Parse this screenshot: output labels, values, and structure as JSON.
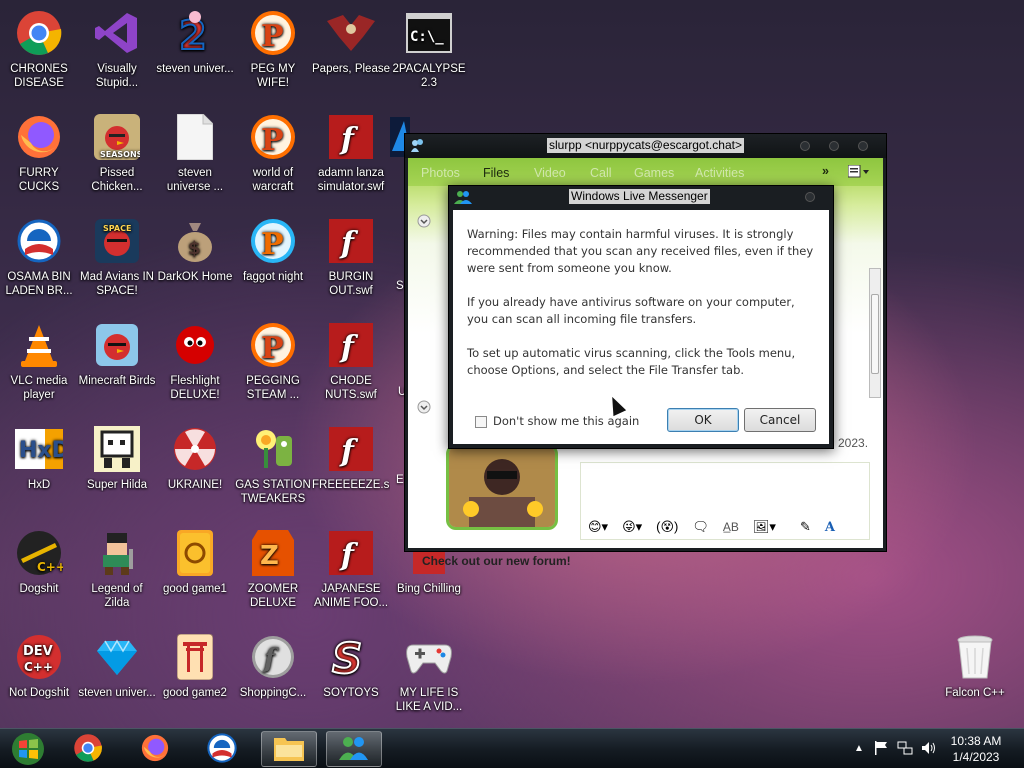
{
  "desktop": {
    "icons": [
      {
        "label": "CHRONES DISEASE",
        "icon": "chrome-icon"
      },
      {
        "label": "Visually Stupid...",
        "icon": "visual-studio-icon"
      },
      {
        "label": "steven univer...",
        "icon": "steven-universe-icon"
      },
      {
        "label": "PEG MY WIFE!",
        "icon": "peggle-icon"
      },
      {
        "label": "Papers, Please",
        "icon": "papers-please-icon"
      },
      {
        "label": "2PACALYPSE 2.3",
        "icon": "terminal-icon"
      },
      {
        "label": "FURRY CUCKS",
        "icon": "firefox-icon"
      },
      {
        "label": "Pissed Chicken...",
        "icon": "angry-birds-seasons-icon"
      },
      {
        "label": "steven universe ...",
        "icon": "blank-file-icon"
      },
      {
        "label": "world of warcraft",
        "icon": "peggle-icon"
      },
      {
        "label": "adamn lanza simulator.swf",
        "icon": "flash-icon"
      },
      {
        "label": "OSAMA BIN LADEN BR...",
        "icon": "obama-logo-icon"
      },
      {
        "label": "Mad Avians IN SPACE!",
        "icon": "angry-birds-space-icon"
      },
      {
        "label": "DarkOK Home",
        "icon": "money-bag-icon"
      },
      {
        "label": "faggot night",
        "icon": "peggle-nights-icon"
      },
      {
        "label": "BURGIN OUT.swf",
        "icon": "flash-icon"
      },
      {
        "label": "VLC media player",
        "icon": "vlc-icon"
      },
      {
        "label": "Minecraft Birds",
        "icon": "angry-birds-icon"
      },
      {
        "label": "Fleshlight DELUXE!",
        "icon": "red-fluffy-icon"
      },
      {
        "label": "PEGGING STEAM ...",
        "icon": "peggle-icon"
      },
      {
        "label": "CHODE NUTS.swf",
        "icon": "flash-icon"
      },
      {
        "label": "HxD",
        "icon": "hxd-icon"
      },
      {
        "label": "Super Hilda",
        "icon": "pixel-sprite-icon"
      },
      {
        "label": "UKRAINE!",
        "icon": "radiation-icon"
      },
      {
        "label": "GAS STATION TWEAKERS",
        "icon": "plants-zombies-icon"
      },
      {
        "label": "FREEEEEZE.s...",
        "icon": "flash-icon"
      },
      {
        "label": "Dogshit",
        "icon": "codeblocks-icon"
      },
      {
        "label": "Legend of Zilda",
        "icon": "pixel-hero-icon"
      },
      {
        "label": "good game1",
        "icon": "mahjong-tile-icon"
      },
      {
        "label": "ZOOMER DELUXE",
        "icon": "zuma-icon"
      },
      {
        "label": "JAPANESE ANIME FOO...",
        "icon": "flash-icon"
      },
      {
        "label": "Bing Chilling",
        "icon": "game-box-icon"
      },
      {
        "label": "Not Dogshit",
        "icon": "devcpp-icon"
      },
      {
        "label": "steven univer...",
        "icon": "gem-icon"
      },
      {
        "label": "good game2",
        "icon": "mahjong-gate-icon"
      },
      {
        "label": "ShoppingC...",
        "icon": "flash-player-icon"
      },
      {
        "label": "SOYTOYS",
        "icon": "soytoys-icon"
      },
      {
        "label": "MY LIFE IS LIKE A VID...",
        "icon": "gamepad-icon"
      },
      {
        "label": "Falcon C++",
        "icon": "recycle-bin-icon"
      }
    ],
    "partial_labels": {
      "s": "S",
      "u": "U",
      "e": "E"
    }
  },
  "messenger": {
    "title": "slurpp <nurppycats@escargot.chat>",
    "tabs": [
      "Photos",
      "Files",
      "Video",
      "Call",
      "Games",
      "Activities"
    ],
    "active_tab": "Files",
    "more": "»",
    "date_fragment": "2023.",
    "footer": "Check out our new forum!"
  },
  "dialog": {
    "title": "Windows Live Messenger",
    "para1": "Warning: Files may contain harmful viruses. It is strongly recommended that you scan any received files, even if they were sent from someone you know.",
    "para2": "If you already have antivirus software on your computer, you can scan all incoming file transfers.",
    "para3": "To set up automatic virus scanning, click the Tools menu, choose Options, and select the File Transfer tab.",
    "checkbox_label": "Don't show me this again",
    "ok": "OK",
    "cancel": "Cancel"
  },
  "taskbar": {
    "time": "10:38 AM",
    "date": "1/4/2023"
  },
  "colors": {
    "msn_green": "#8ec63f",
    "taskbar": "#141b22"
  }
}
